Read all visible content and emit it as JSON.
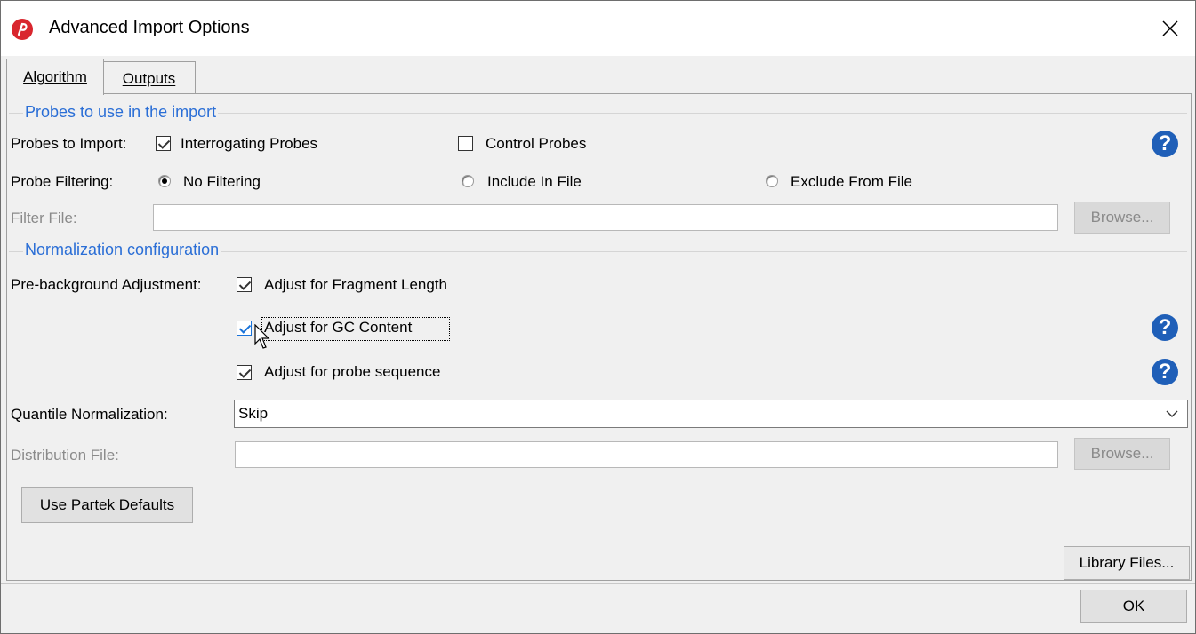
{
  "window": {
    "title": "Advanced Import Options",
    "app_icon": "partek-logo-icon",
    "close_icon": "close-icon"
  },
  "tabs": [
    {
      "label": "Algorithm",
      "active": true
    },
    {
      "label": "Outputs",
      "active": false
    }
  ],
  "probes_group": {
    "title": "Probes to use in the import",
    "probes_to_import_label": "Probes to Import:",
    "interrogating": {
      "label": "Interrogating Probes",
      "checked": true
    },
    "control": {
      "label": "Control Probes",
      "checked": false
    },
    "probe_filtering_label": "Probe Filtering:",
    "filter_options": [
      {
        "label": "No Filtering",
        "selected": true
      },
      {
        "label": "Include In File",
        "selected": false
      },
      {
        "label": "Exclude From File",
        "selected": false
      }
    ],
    "filter_file_label": "Filter File:",
    "filter_file_value": "",
    "browse_label": "Browse..."
  },
  "normalization_group": {
    "title": "Normalization configuration",
    "pre_bg_label": "Pre-background Adjustment:",
    "fragment_length": {
      "label": "Adjust for Fragment Length",
      "checked": true
    },
    "gc_content": {
      "label": "Adjust for GC Content",
      "checked": true
    },
    "probe_sequence": {
      "label": "Adjust for probe sequence",
      "checked": true
    },
    "quantile_label": "Quantile Normalization:",
    "quantile_value": "Skip",
    "distribution_file_label": "Distribution File:",
    "distribution_file_value": "",
    "browse_label": "Browse..."
  },
  "buttons": {
    "use_defaults": "Use Partek Defaults",
    "library_files": "Library Files...",
    "ok": "OK"
  },
  "help_icon_glyph": "?",
  "colors": {
    "group_title": "#2a6ed6",
    "help_icon": "#1f5fb8",
    "app_icon": "#d9262e"
  }
}
